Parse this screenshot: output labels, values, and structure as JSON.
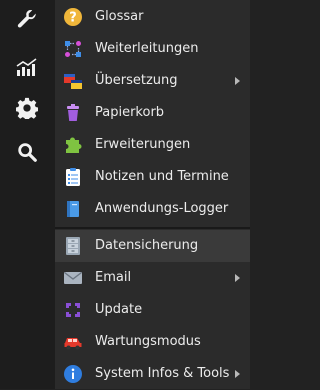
{
  "sidebar": {
    "icons": [
      "wrench-icon",
      "statistics-chart-icon",
      "gear-icon",
      "search-icon"
    ]
  },
  "menu": {
    "items": [
      {
        "label": "Glossar",
        "icon": "question-circle-icon",
        "submenu": false
      },
      {
        "label": "Weiterleitungen",
        "icon": "redirect-nodes-icon",
        "submenu": false
      },
      {
        "label": "Übersetzung",
        "icon": "translation-flags-icon",
        "submenu": true
      },
      {
        "label": "Papierkorb",
        "icon": "trash-bin-icon",
        "submenu": false
      },
      {
        "label": "Erweiterungen",
        "icon": "puzzle-piece-icon",
        "submenu": false
      },
      {
        "label": "Notizen und Termine",
        "icon": "clipboard-notes-icon",
        "submenu": false
      },
      {
        "label": "Anwendungs-Logger",
        "icon": "logbook-icon",
        "submenu": false
      },
      {
        "label": "Datensicherung",
        "icon": "cabinet-backup-icon",
        "submenu": false
      },
      {
        "label": "Email",
        "icon": "envelope-icon",
        "submenu": true
      },
      {
        "label": "Update",
        "icon": "update-cycle-icon",
        "submenu": false
      },
      {
        "label": "Wartungsmodus",
        "icon": "car-maintenance-icon",
        "submenu": false
      },
      {
        "label": "System Infos & Tools",
        "icon": "info-circle-icon",
        "submenu": true
      }
    ],
    "active_item": "Datensicherung"
  },
  "colors": {
    "background": "#222222",
    "sidebar": "#1d1d1d",
    "menu": "#2b2b2b",
    "highlight": "#3a3a3a",
    "text": "#ececec"
  }
}
